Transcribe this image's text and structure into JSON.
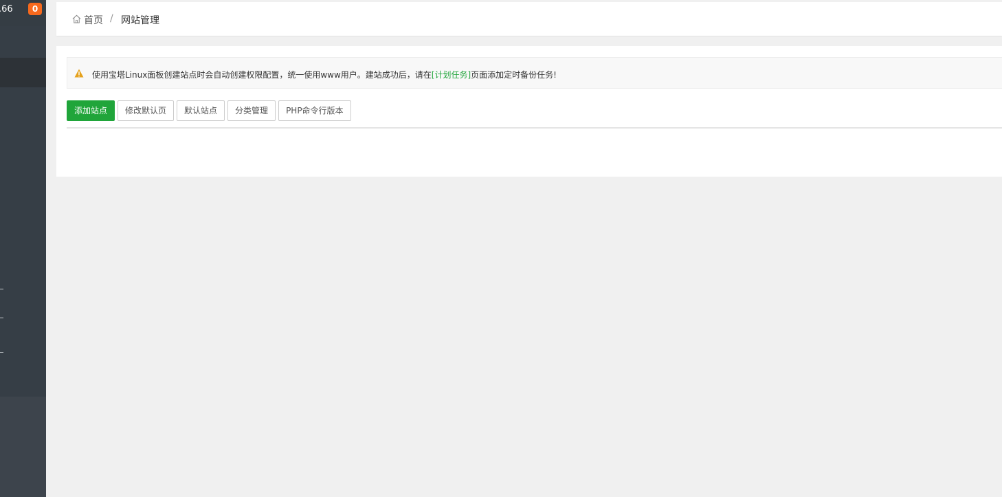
{
  "sidebar": {
    "ip_suffix": ".66",
    "notification_count": "0",
    "badge_color": "#f7691d"
  },
  "breadcrumb": {
    "home": "首页",
    "separator": "/",
    "current": "网站管理"
  },
  "alert": {
    "text_before": "使用宝塔Linux面板创建站点时会自动创建权限配置，统一使用www用户。建站成功后，请在",
    "link": "[计划任务]",
    "text_after": "页面添加定时备份任务!"
  },
  "toolbar": {
    "add_site": "添加站点",
    "edit_default_page": "修改默认页",
    "default_site": "默认站点",
    "category_manage": "分类管理",
    "php_cli_version": "PHP命令行版本"
  },
  "colors": {
    "accent": "#20a53a",
    "warning": "#e5a11c",
    "sidebar_bg": "#363e46"
  }
}
